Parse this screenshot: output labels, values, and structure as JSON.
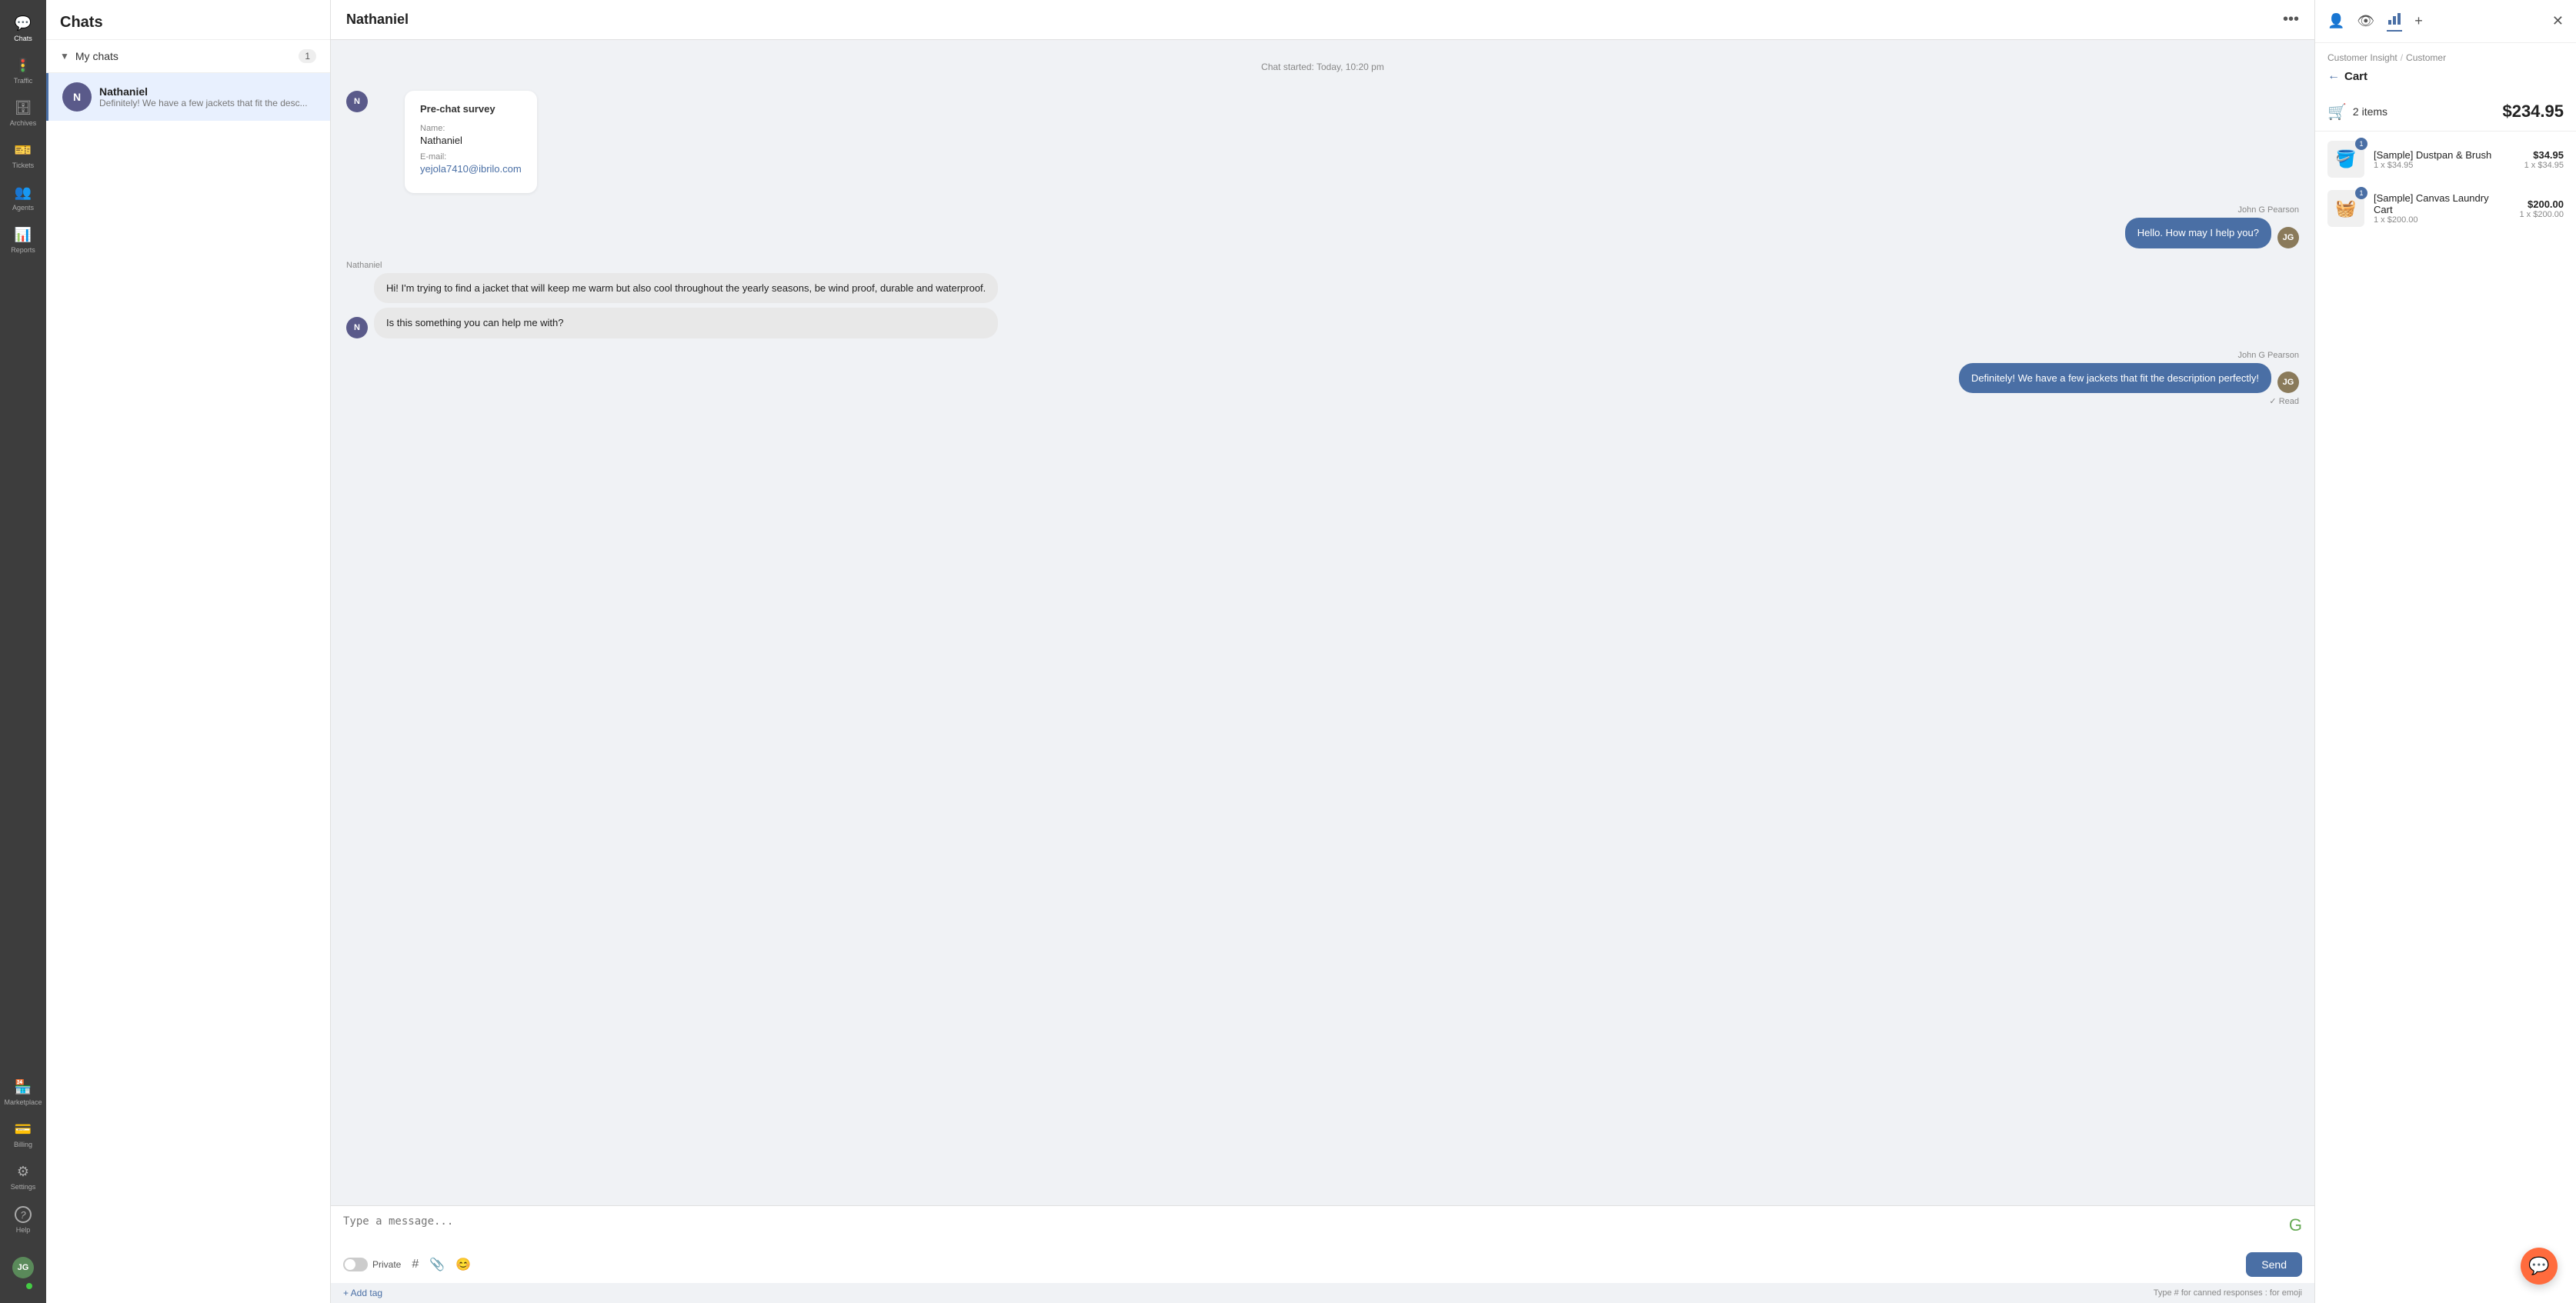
{
  "sidebar": {
    "items": [
      {
        "id": "chat-icon",
        "label": "Chats",
        "icon": "💬",
        "active": true
      },
      {
        "id": "traffic-icon",
        "label": "Traffic",
        "icon": "🚦"
      },
      {
        "id": "archives-icon",
        "label": "Archives",
        "icon": "🗄"
      },
      {
        "id": "tickets-icon",
        "label": "Tickets",
        "icon": "🎫"
      },
      {
        "id": "agents-icon",
        "label": "Agents",
        "icon": "👥"
      },
      {
        "id": "reports-icon",
        "label": "Reports",
        "icon": "📊"
      },
      {
        "id": "marketplace-icon",
        "label": "Marketplace",
        "icon": "🏪"
      },
      {
        "id": "billing-icon",
        "label": "Billing",
        "icon": "💳"
      },
      {
        "id": "settings-icon",
        "label": "Settings",
        "icon": "⚙"
      },
      {
        "id": "help-icon",
        "label": "Help",
        "icon": "?"
      }
    ],
    "avatar_initials": "JG"
  },
  "chats_panel": {
    "title": "Chats",
    "my_chats_label": "My chats",
    "my_chats_count": "1",
    "chat_list": [
      {
        "name": "Nathaniel",
        "preview": "Definitely! We have a few jackets that fit the desc...",
        "avatar_initial": "N",
        "selected": true
      }
    ]
  },
  "chat_area": {
    "header_name": "Nathaniel",
    "chat_started": "Chat started: Today, 10:20 pm",
    "survey": {
      "title": "Pre-chat survey",
      "name_label": "Name:",
      "name_value": "Nathaniel",
      "email_label": "E-mail:",
      "email_value": "yejola7410@ibrilo.com"
    },
    "messages": [
      {
        "type": "outgoing",
        "sender": "John G Pearson",
        "text": "Hello. How may I help you?"
      },
      {
        "type": "incoming_multi",
        "sender": "Nathaniel",
        "bubbles": [
          "Hi! I'm trying to find a jacket that will keep me warm but also cool throughout the yearly seasons, be wind proof, durable and waterproof.",
          "Is this something you can help me with?"
        ]
      },
      {
        "type": "outgoing",
        "sender": "John G Pearson",
        "text": "Definitely! We have a few jackets that fit the description perfectly!",
        "read_status": "✓ Read"
      }
    ],
    "input_placeholder": "Type a message...",
    "private_label": "Private",
    "send_label": "Send",
    "add_tag_label": "+ Add tag",
    "footer_hint": "Type # for canned responses  :  for emoji"
  },
  "right_panel": {
    "breadcrumb_part1": "Customer Insight",
    "breadcrumb_sep": "/",
    "breadcrumb_part2": "Customer",
    "back_label": "Cart",
    "cart_icon": "🛒",
    "items_label": "2 items",
    "total": "$234.95",
    "items": [
      {
        "name": "[Sample] Dustpan & Brush",
        "qty_label": "1 x $34.95",
        "price": "$34.95",
        "badge": "1",
        "icon": "🪣"
      },
      {
        "name": "[Sample] Canvas Laundry Cart",
        "qty_label": "1 x $200.00",
        "price": "$200.00",
        "badge": "1",
        "icon": "🧺"
      }
    ]
  }
}
